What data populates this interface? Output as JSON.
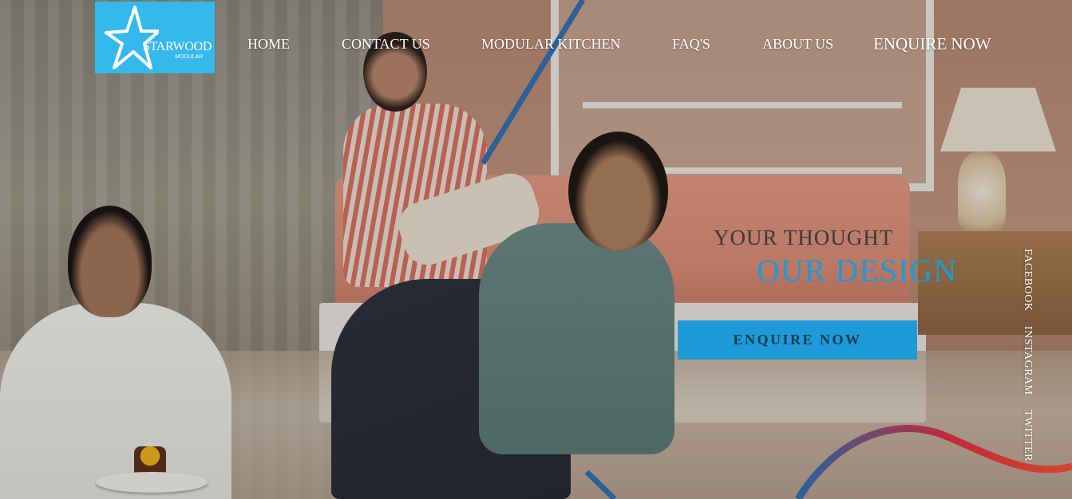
{
  "brand": {
    "name": "STARWOOD",
    "tagline": "MODULAR",
    "logo_color": "#35b8ec",
    "logo_icon": "star-icon"
  },
  "nav": {
    "items": [
      {
        "label": "HOME"
      },
      {
        "label": "CONTACT US"
      },
      {
        "label": "MODULAR KITCHEN"
      },
      {
        "label": "FAQ'S"
      },
      {
        "label": "ABOUT US"
      }
    ],
    "enquire_label": "ENQUIRE NOW"
  },
  "hero": {
    "line1": "YOUR THOUGHT",
    "line2": "OUR DESIGN",
    "cta_label": "ENQUIRE NOW",
    "accent_color": "#1e9ad8"
  },
  "social": {
    "items": [
      {
        "label": "FACEBOOK"
      },
      {
        "label": "INSTAGRAM"
      },
      {
        "label": "TWITTER"
      }
    ]
  }
}
